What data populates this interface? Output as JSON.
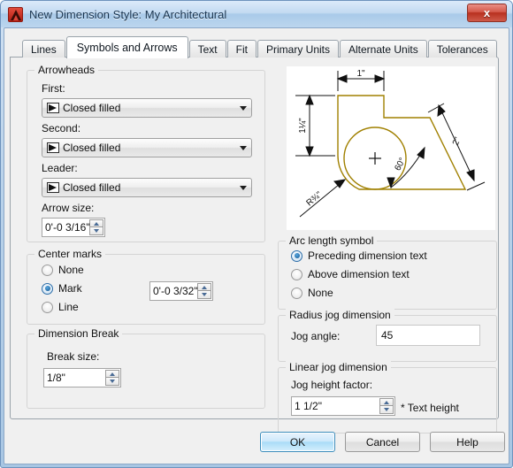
{
  "window": {
    "title": "New Dimension Style: My Architectural",
    "icon": "autocad-logo-icon",
    "close_label": "x"
  },
  "tabs": [
    {
      "label": "Lines",
      "active": false
    },
    {
      "label": "Symbols and Arrows",
      "active": true
    },
    {
      "label": "Text",
      "active": false
    },
    {
      "label": "Fit",
      "active": false
    },
    {
      "label": "Primary Units",
      "active": false
    },
    {
      "label": "Alternate Units",
      "active": false
    },
    {
      "label": "Tolerances",
      "active": false
    }
  ],
  "arrowheads": {
    "legend": "Arrowheads",
    "first_label": "First:",
    "first_value": "Closed filled",
    "second_label": "Second:",
    "second_value": "Closed filled",
    "leader_label": "Leader:",
    "leader_value": "Closed filled",
    "arrow_size_label": "Arrow size:",
    "arrow_size_value": "0'-0 3/16\""
  },
  "center_marks": {
    "legend": "Center marks",
    "options": [
      {
        "label": "None",
        "checked": false
      },
      {
        "label": "Mark",
        "checked": true
      },
      {
        "label": "Line",
        "checked": false
      }
    ],
    "size_value": "0'-0 3/32\""
  },
  "dimension_break": {
    "legend": "Dimension Break",
    "break_size_label": "Break size:",
    "break_size_value": "1/8\""
  },
  "arc_length_symbol": {
    "legend": "Arc length symbol",
    "options": [
      {
        "label": "Preceding dimension text",
        "checked": true
      },
      {
        "label": "Above dimension text",
        "checked": false
      },
      {
        "label": "None",
        "checked": false
      }
    ]
  },
  "radius_jog": {
    "legend": "Radius jog dimension",
    "jog_angle_label": "Jog angle:",
    "jog_angle_value": "45"
  },
  "linear_jog": {
    "legend": "Linear jog dimension",
    "jog_height_label": "Jog height factor:",
    "jog_height_value": "1 1/2\"",
    "suffix": "* Text height"
  },
  "preview": {
    "dim_top": "1\"",
    "dim_left": "1¼\"",
    "dim_radius": "R¾\"",
    "dim_angle": "60°",
    "dim_right": "2\"",
    "center_mark": "+",
    "geometry_color": "#A08000"
  },
  "buttons": {
    "ok": "OK",
    "cancel": "Cancel",
    "help": "Help"
  }
}
